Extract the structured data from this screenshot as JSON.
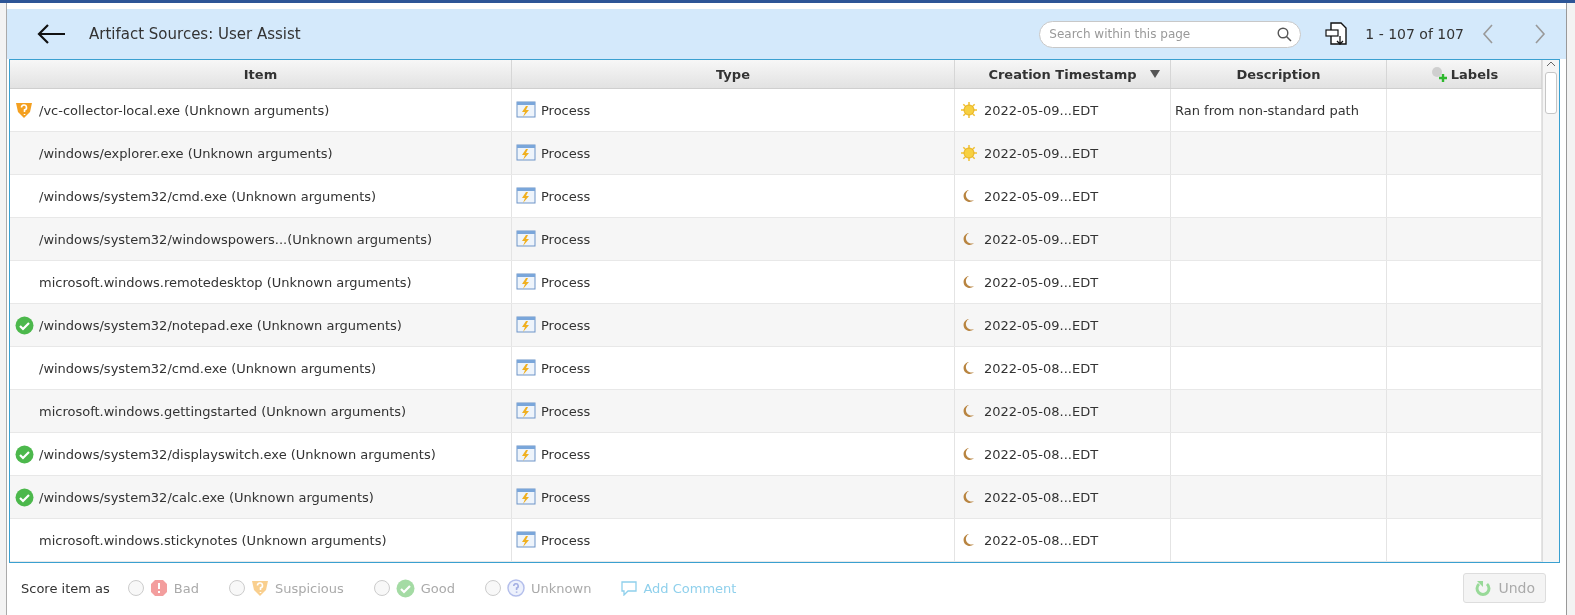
{
  "header": {
    "title": "Artifact Sources: User Assist",
    "search": {
      "placeholder": "Search within this page"
    },
    "pagination": "1 - 107 of 107"
  },
  "table": {
    "columns": [
      {
        "label": "Item",
        "sorted": false
      },
      {
        "label": "Type",
        "sorted": false
      },
      {
        "label": "Creation Timestamp",
        "sorted": true
      },
      {
        "label": "Description",
        "sorted": false
      },
      {
        "label": "Labels",
        "sorted": false
      }
    ],
    "rows": [
      {
        "kind": "suspicious",
        "item": "/vc-collector-local.exe (Unknown arguments)",
        "type": "Process",
        "daytime": true,
        "timestamp": "2022-05-09...EDT",
        "description": "Ran from non-standard path"
      },
      {
        "kind": "plain",
        "item": "/windows/explorer.exe (Unknown arguments)",
        "type": "Process",
        "daytime": true,
        "timestamp": "2022-05-09...EDT"
      },
      {
        "kind": "plain",
        "item": "/windows/system32/cmd.exe (Unknown arguments)",
        "type": "Process",
        "daytime": false,
        "timestamp": "2022-05-09...EDT"
      },
      {
        "kind": "plain",
        "item": "/windows/system32/windowspowers...(Unknown arguments)",
        "type": "Process",
        "daytime": false,
        "timestamp": "2022-05-09...EDT"
      },
      {
        "kind": "plain",
        "item": "microsoft.windows.remotedesktop (Unknown arguments)",
        "type": "Process",
        "daytime": false,
        "timestamp": "2022-05-09...EDT"
      },
      {
        "kind": "good",
        "item": "/windows/system32/notepad.exe (Unknown arguments)",
        "type": "Process",
        "daytime": false,
        "timestamp": "2022-05-09...EDT"
      },
      {
        "kind": "plain",
        "item": "/windows/system32/cmd.exe (Unknown arguments)",
        "type": "Process",
        "daytime": false,
        "timestamp": "2022-05-08...EDT"
      },
      {
        "kind": "plain",
        "item": "microsoft.windows.gettingstarted (Unknown arguments)",
        "type": "Process",
        "daytime": false,
        "timestamp": "2022-05-08...EDT"
      },
      {
        "kind": "good",
        "item": "/windows/system32/displayswitch.exe (Unknown arguments)",
        "type": "Process",
        "daytime": false,
        "timestamp": "2022-05-08...EDT"
      },
      {
        "kind": "good",
        "item": "/windows/system32/calc.exe (Unknown arguments)",
        "type": "Process",
        "daytime": false,
        "timestamp": "2022-05-08...EDT"
      },
      {
        "kind": "plain",
        "item": "microsoft.windows.stickynotes (Unknown arguments)",
        "type": "Process",
        "daytime": false,
        "timestamp": "2022-05-08...EDT"
      }
    ]
  },
  "footer": {
    "label": "Score item as",
    "options": [
      {
        "kind": "bad",
        "label": "Bad",
        "selected": false
      },
      {
        "kind": "suspicious",
        "label": "Suspicious",
        "selected": false
      },
      {
        "kind": "good",
        "label": "Good",
        "selected": false
      },
      {
        "kind": "unknown",
        "label": "Unknown",
        "selected": false
      }
    ],
    "add_comment": "Add Comment",
    "undo": {
      "label": "Undo",
      "disabled": true
    }
  }
}
